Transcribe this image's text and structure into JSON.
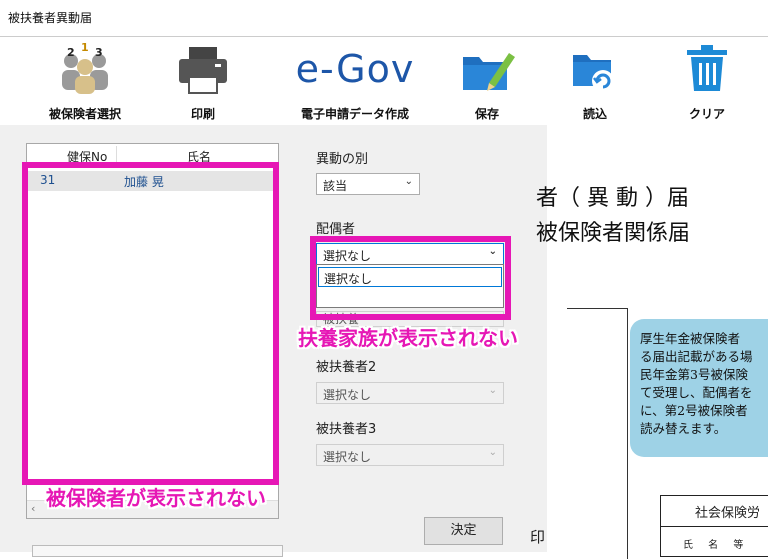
{
  "window": {
    "title": "被扶養者異動届"
  },
  "toolbar": {
    "buttons": [
      {
        "id": "select",
        "label": "被保険者選択",
        "icon": "people-numbers-icon"
      },
      {
        "id": "print",
        "label": "印刷",
        "icon": "printer-icon"
      },
      {
        "id": "egov",
        "label": "電子申請データ作成",
        "logo": "e-Gov"
      },
      {
        "id": "save",
        "label": "保存",
        "icon": "folder-pencil-icon"
      },
      {
        "id": "load",
        "label": "読込",
        "icon": "folder-refresh-icon"
      },
      {
        "id": "clear",
        "label": "クリア",
        "icon": "trash-icon"
      }
    ]
  },
  "list": {
    "columns": [
      "健保No",
      "氏名"
    ],
    "rows": [
      {
        "no": "31",
        "name": "加藤 晃"
      }
    ]
  },
  "form": {
    "ido_label": "異動の別",
    "ido_value": "該当",
    "haigusha_label": "配偶者",
    "haigusha_value": "選択なし",
    "dropdown_option": "選択なし",
    "partial_label": "被扶養",
    "hifuyou2_label": "被扶養者2",
    "hifuyou2_value": "選択なし",
    "hifuyou3_label": "被扶養者3",
    "hifuyou3_value": "選択なし",
    "decide_label": "決定"
  },
  "annotations": {
    "family_not_shown": "扶養家族が表示されない",
    "insured_not_shown": "被保険者が表示されない",
    "highlight_color": "#e617b5"
  },
  "document": {
    "title_line1": "者（ 異 動 ）届",
    "title_line2": "被保険者関係届",
    "info_lines": [
      "厚生年金被保険者",
      "る届出記載がある場",
      "民年金第3号被保険",
      "て受理し、配偶者を",
      "に、第2号被保険者",
      "読み替えます。"
    ],
    "table_title": "社会保険労",
    "table_sub": "氏 名 等",
    "circle_char": "印",
    "info_color": "#9ed2e6"
  }
}
